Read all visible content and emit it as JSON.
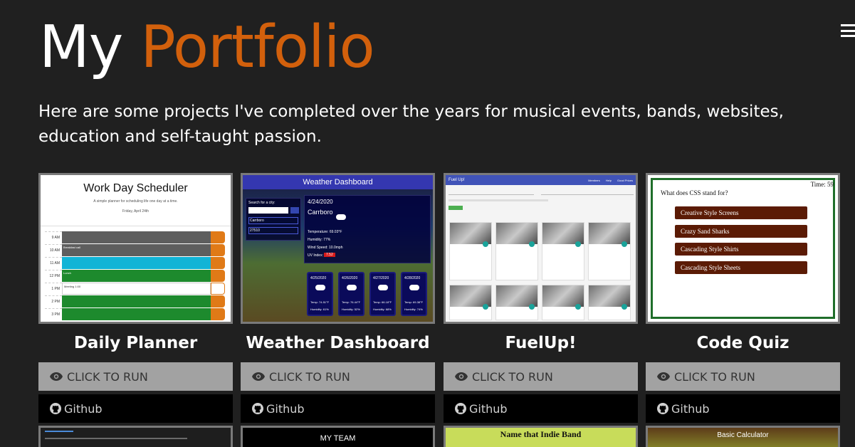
{
  "header": {
    "title_part1": "My",
    "title_part2": "Portfolio",
    "intro": "Here are some projects I've completed over the years for musical events, bands, websites, education and self-taught passion."
  },
  "colors": {
    "accent": "#d2600c",
    "background": "#202020",
    "run_button": "#a2a2a2",
    "github_button": "#000000"
  },
  "projects": [
    {
      "title": "Daily Planner",
      "run_label": "CLICK TO RUN",
      "github_label": "Github",
      "thumb": {
        "heading": "Work Day Scheduler",
        "subheading": "A simple planner for scheduling life one day at a time.",
        "date": "Friday, April 24th",
        "rows": [
          {
            "hour": "9 AM",
            "text": ""
          },
          {
            "hour": "10 AM",
            "text": "Breakfast call"
          },
          {
            "hour": "11 AM",
            "text": ""
          },
          {
            "hour": "12 PM",
            "text": "Lunch"
          },
          {
            "hour": "1 PM",
            "text": "Meeting 1:00"
          },
          {
            "hour": "2 PM",
            "text": ""
          },
          {
            "hour": "3 PM",
            "text": ""
          }
        ]
      }
    },
    {
      "title": "Weather Dashboard",
      "run_label": "CLICK TO RUN",
      "github_label": "Github",
      "thumb": {
        "heading": "Weather Dashboard",
        "search_label": "Search for a city:",
        "city_item_1": "Carrboro",
        "city_item_2": "27510",
        "date": "4/24/2020",
        "city": "Carrboro",
        "temperature": "Temperature: 69.03°F",
        "humidity": "Humidity: 77%",
        "wind": "Wind Speed: 10.0mph",
        "uv": "UV Index:",
        "uv_value": "7.52",
        "forecast": [
          {
            "date": "4/25/2020",
            "temp": "Temp: 74.51°F",
            "humidity": "Humidity: 61%"
          },
          {
            "date": "4/26/2020",
            "temp": "Temp: 76.44°F",
            "humidity": "Humidity: 52%"
          },
          {
            "date": "4/27/2020",
            "temp": "Temp: 66.18°F",
            "humidity": "Humidity: 68%"
          },
          {
            "date": "4/28/2020",
            "temp": "Temp: 69.38°F",
            "humidity": "Humidity: 74%"
          }
        ]
      }
    },
    {
      "title": "FuelUp!",
      "run_label": "CLICK TO RUN",
      "github_label": "Github",
      "thumb": {
        "brand": "Fuel Up!",
        "nav": [
          "Members",
          "Help",
          "Good Prices"
        ]
      }
    },
    {
      "title": "Code Quiz",
      "run_label": "CLICK TO RUN",
      "github_label": "Github",
      "thumb": {
        "timer": "Time: 59",
        "question": "What does CSS stand for?",
        "answers": [
          "Creative Style Screens",
          "Crazy Sand Sharks",
          "Cascading Style Shirts",
          "Cascading Style Sheets"
        ]
      }
    }
  ],
  "row2": [
    {
      "label": ""
    },
    {
      "label": "MY TEAM"
    },
    {
      "label": "Name that Indie Band"
    },
    {
      "label": "Basic Calculator"
    }
  ]
}
